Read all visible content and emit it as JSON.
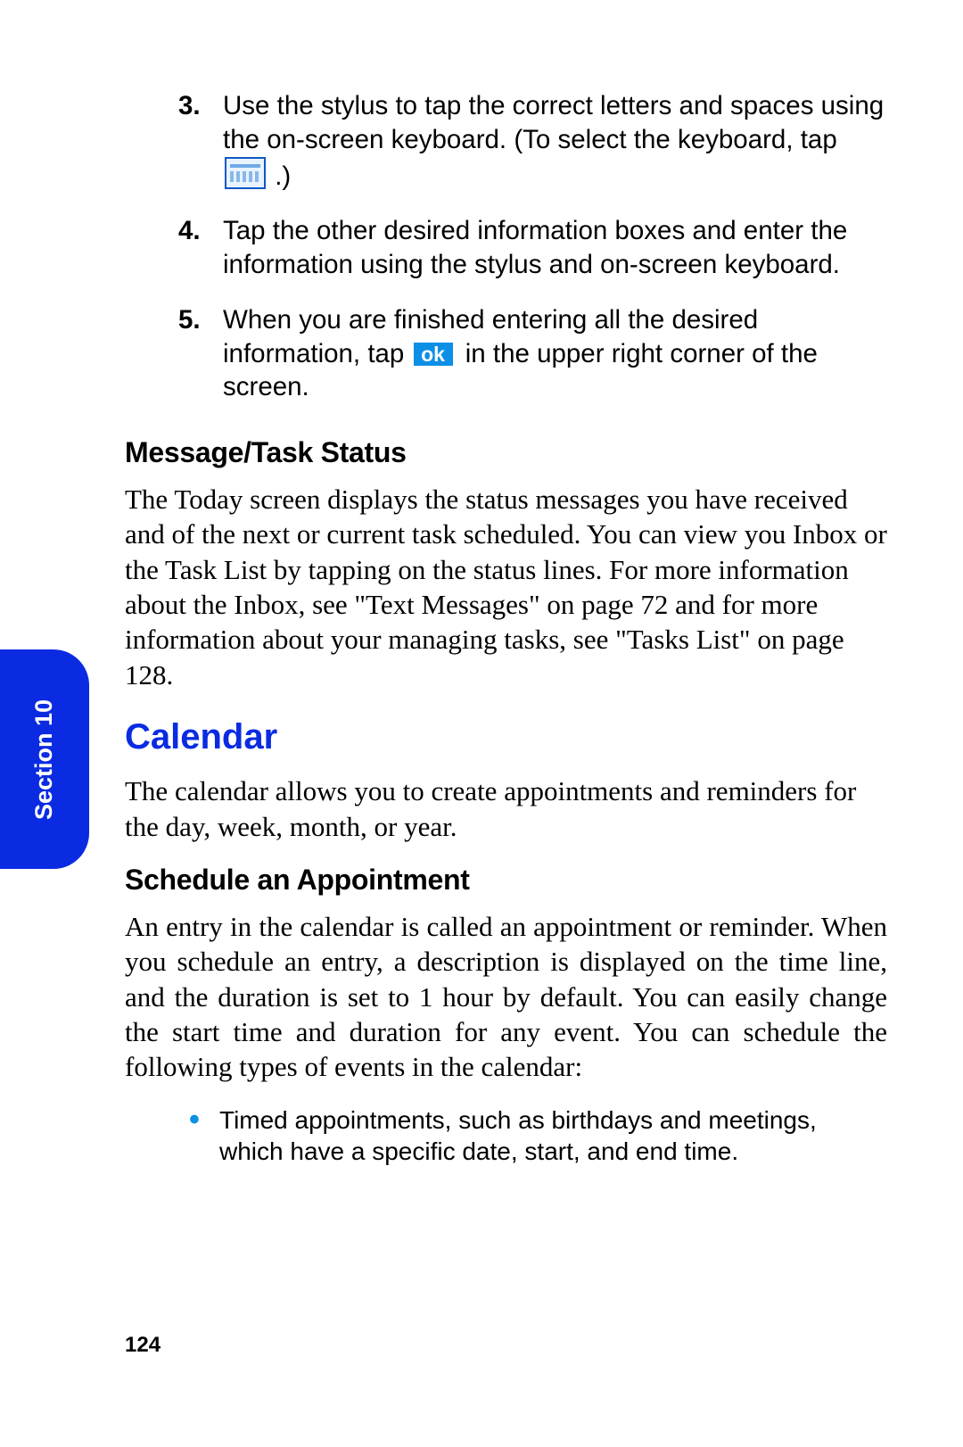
{
  "side_tab": {
    "label": "Section 10"
  },
  "steps": [
    {
      "num": "3.",
      "text_before_icon": "Use the stylus to tap the correct letters and spaces using the on-screen keyboard. (To select the keyboard, tap ",
      "icon_name": "keyboard-icon",
      "text_after_icon": " .)"
    },
    {
      "num": "4.",
      "text": "Tap the other desired information boxes and enter the information using the stylus and on-screen keyboard."
    },
    {
      "num": "5.",
      "text_before_icon": "When you are finished entering all the desired information, tap ",
      "icon_label": "ok",
      "text_after_icon": " in the upper right corner of the screen."
    }
  ],
  "section_msg_task": {
    "heading": "Message/Task Status",
    "body": "The Today screen displays the status messages you have received and of the next or current task scheduled. You can view you Inbox or the Task List by tapping on the status lines. For more information about the Inbox, see \"Text Messages\" on page 72 and for more information about your managing tasks, see \"Tasks List\" on page 128."
  },
  "section_calendar": {
    "heading": "Calendar",
    "intro": "The calendar allows you to create appointments and reminders for the day, week, month, or year.",
    "sub_heading": "Schedule an Appointment",
    "body": "An entry in the calendar is called an appointment or reminder. When you schedule an entry, a description is displayed on the time line, and the duration is set to 1 hour by default. You can easily change the start time and duration for any event. You can schedule the following types of events in the calendar:",
    "bullets": [
      "Timed appointments, such as birthdays and meetings, which have a specific date, start, and end time."
    ]
  },
  "page_number": "124"
}
